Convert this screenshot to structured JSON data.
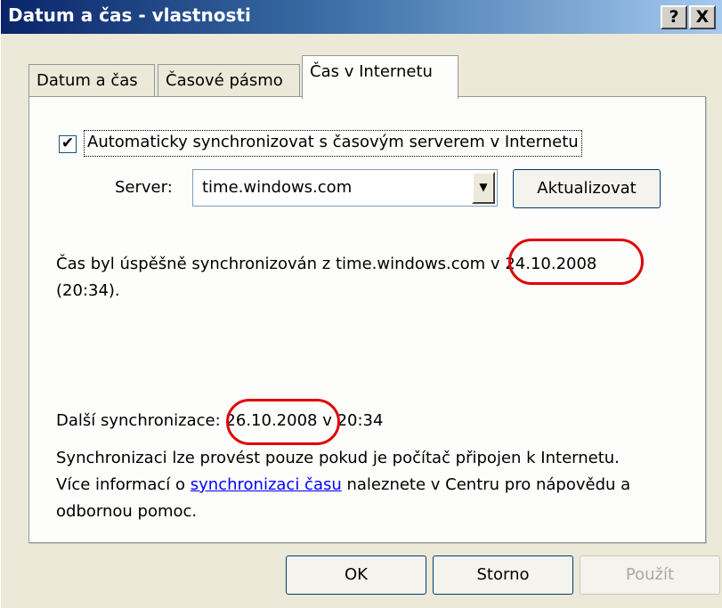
{
  "window": {
    "title": "Datum a čas - vlastnosti"
  },
  "titlebar_buttons": {
    "help": "?",
    "close": "X"
  },
  "tabs": [
    {
      "label": "Datum a čas"
    },
    {
      "label": "Časové pásmo"
    },
    {
      "label": "Čas v Internetu"
    }
  ],
  "sync": {
    "auto_checkbox_checked": true,
    "auto_label": "Automaticky synchronizovat s časovým serverem v Internetu",
    "server_label": "Server:",
    "server_value": "time.windows.com",
    "update_button": "Aktualizovat",
    "status_prefix": "Čas byl úspěšně synchronizován z time.windows.com",
    "status_v": " v ",
    "status_date": "24.10.2008",
    "status_time": "(20:34).",
    "next_label": "Další synchronizace:",
    "next_date": "26.10.2008",
    "next_time_suffix": " v 20:34",
    "info_line1": "Synchronizaci lze provést pouze pokud je počítač připojen k Internetu.",
    "info_line2_pre": "Více informací o ",
    "info_link": "synchronizaci času",
    "info_line2_post": " naleznete v Centru pro nápovědu a",
    "info_line3": "odbornou pomoc."
  },
  "buttons": {
    "ok": "OK",
    "cancel": "Storno",
    "apply": "Použít"
  },
  "colors": {
    "annotation_circle": "#e00000",
    "link": "#0000ff"
  }
}
